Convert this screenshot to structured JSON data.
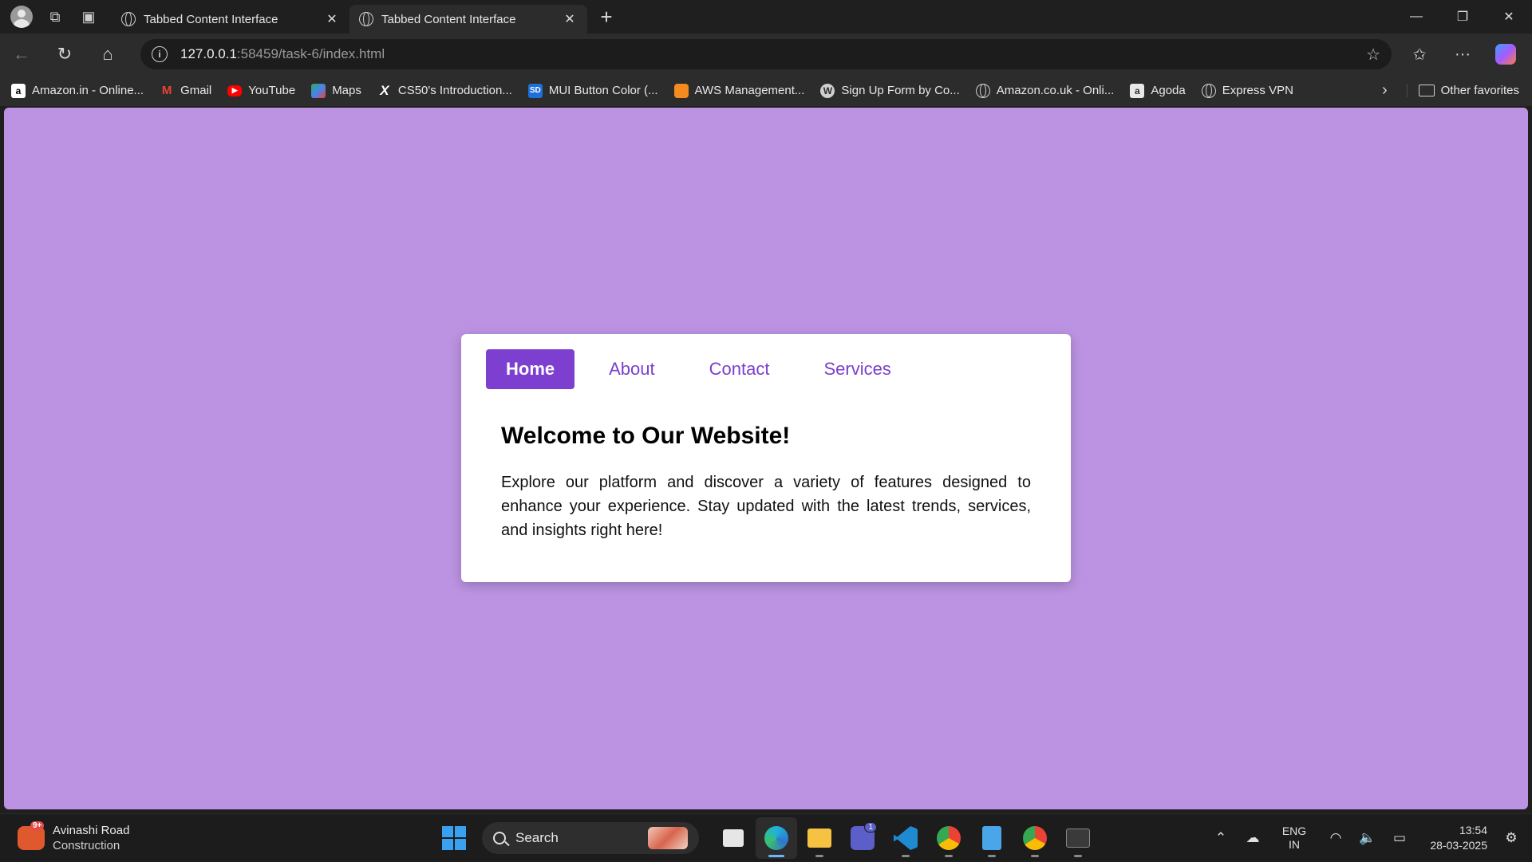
{
  "browser": {
    "tabs": [
      {
        "title": "Tabbed Content Interface",
        "active": false
      },
      {
        "title": "Tabbed Content Interface",
        "active": true
      }
    ],
    "address": {
      "host": "127.0.0.1",
      "path": ":58459/task-6/index.html"
    },
    "bookmarks": [
      {
        "label": "Amazon.in - Online...",
        "icon": "amazon-icon"
      },
      {
        "label": "Gmail",
        "icon": "gmail-icon"
      },
      {
        "label": "YouTube",
        "icon": "youtube-icon"
      },
      {
        "label": "Maps",
        "icon": "maps-icon"
      },
      {
        "label": "CS50's Introduction...",
        "icon": "edx-icon"
      },
      {
        "label": "MUI Button Color (...",
        "icon": "sd-icon"
      },
      {
        "label": "AWS Management...",
        "icon": "aws-icon"
      },
      {
        "label": "Sign Up Form by Co...",
        "icon": "wordpress-icon"
      },
      {
        "label": "Amazon.co.uk - Onli...",
        "icon": "globe-icon"
      },
      {
        "label": "Agoda",
        "icon": "agoda-icon"
      },
      {
        "label": "Express VPN",
        "icon": "globe-icon"
      }
    ],
    "other_favorites": "Other favorites"
  },
  "page": {
    "background": "#bb93e2",
    "accent": "#7d3fd0",
    "tabs": [
      {
        "label": "Home",
        "active": true
      },
      {
        "label": "About",
        "active": false
      },
      {
        "label": "Contact",
        "active": false
      },
      {
        "label": "Services",
        "active": false
      }
    ],
    "heading": "Welcome to Our Website!",
    "body": "Explore our platform and discover a variety of features designed to enhance your experience. Stay updated with the latest trends, services, and insights right here!"
  },
  "taskbar": {
    "weather": {
      "title": "Avinashi Road",
      "subtitle": "Construction",
      "badge": "9+"
    },
    "search_label": "Search",
    "teams_badge": "1",
    "language": {
      "line1": "ENG",
      "line2": "IN"
    },
    "clock": {
      "time": "13:54",
      "date": "28-03-2025"
    }
  }
}
